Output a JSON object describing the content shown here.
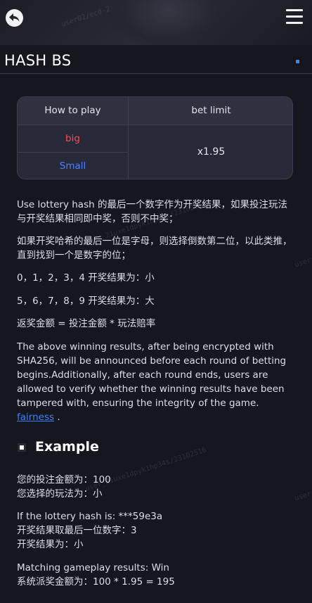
{
  "header": {
    "back_icon": "back-arrow-icon",
    "menu_icon": "hamburger-menu-icon"
  },
  "page": {
    "title": "HASH BS"
  },
  "rules_table": {
    "col_how_to_play": "How to play",
    "col_bet_limit": "bet limit",
    "big_label": "big",
    "small_label": "Small",
    "odds": "x1.95",
    "colors": {
      "big": "#ff4b4b",
      "small": "#4b82ff"
    }
  },
  "rules_text": {
    "p1": "Use lottery hash 的最后一个数字作为开奖结果，如果投注玩法与开奖结果相同即中奖，否则不中奖；",
    "p2": "如果开奖哈希的最后一位是字母，则选择倒数第二位，以此类推，直到找到一个是数字的位；",
    "p3": "0，1，2，3，4 开奖结果为：小",
    "p4": "5，6，7，8，9 开奖结果为：大",
    "p5": "返奖金额 = 投注金额 * 玩法赔率",
    "p6": "The above winning results, after being encrypted with SHA256, will be announced before each round of betting begins.Additionally, after each round ends, users are allowed to verify whether the winning results have been tampered with, ensuring the integrity of the game.",
    "fairness_link": "fairness",
    "p6_end": " ."
  },
  "example": {
    "title": "Example",
    "bet_amount": "您的投注金额为：100",
    "chosen_play": "您选择的玩法为：小",
    "hash_line": "If the lottery hash is: ***59e3a",
    "last_digit": "开奖结果取最后一位数字：3",
    "result": "开奖结果为：小",
    "match": "Matching gameplay results: Win",
    "payout": "系统派奖金额为：100 * 1.95 = 195"
  },
  "watermark": {
    "w1": "user02/ecd-2",
    "w2": "user_21uxe1dpyk1hp34s/23102516",
    "w3": "user"
  }
}
